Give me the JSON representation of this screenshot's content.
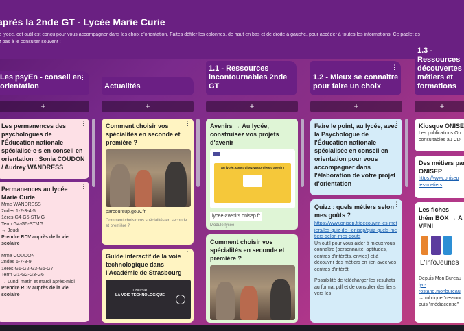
{
  "header": {
    "title": "après la 2nde GT - Lycée Marie Curie",
    "description": "e lycée, cet outil est conçu pour vous accompagner dans les choix d'orientation. Faites défiler les colonnes, de haut en bas et de droite à gauche, pour accéder à toutes les informations. Ce padlet es",
    "description2": "z pas à le consulter souvent !"
  },
  "columns": [
    {
      "title": "Les psyEn - conseil en orientation"
    },
    {
      "title": "Actualités"
    },
    {
      "title": "1.1 - Ressources incontournables 2nde GT"
    },
    {
      "title": "1.2 - Mieux se connaître pour faire un choix"
    },
    {
      "title": "1.3 - Ressources découvertes métiers et formations"
    }
  ],
  "add_symbol": "+",
  "menu_symbol": "⋮",
  "cards": {
    "c1a": {
      "title": "Les permanences des psychologues de l'Éducation nationale spécialisé-e-s en conseil en orientation : Sonia COUDON / Audrey WANDRESS"
    },
    "c1b": {
      "title": "Permanences au lycée Marie Curie",
      "l1": "Mme WANDRESS",
      "l2": "2ndes 1-2-3-4-5",
      "l3": "1ères G4-G5-STMG",
      "l4": "Term G4-G5-STMG",
      "l5": "→ Jeudi",
      "l6": "Prendre RDV auprès de la vie scolaire",
      "l7": "Mme COUDON",
      "l8": "2ndes 6-7-8-9",
      "l9": "1ères G1-G2-G3-G6-G7",
      "l10": "Term G1-G2-G3-G6",
      "l11": "→ Lundi matin et mardi après-midi",
      "l12": "Prendre RDV auprès de la vie scolaire"
    },
    "c2a": {
      "title": "Comment choisir vos spécialités en seconde et première ?",
      "link": "parcoursup.gouv.fr",
      "caption": "Comment choisir vos spécialités en seconde et première ?"
    },
    "c2b": {
      "title": "Guide interactif de la voie technologique dans l'Académie de Strasbourg",
      "img_text1": "CHOISIR",
      "img_text2": "LA VOIE TECHNOLOGIQUE"
    },
    "c3a": {
      "title": "Avenirs → Au lycée, construisez vos projets d'avenir",
      "img_text": "Au lycée, construisez vos projets d'avenir !",
      "link": "lycee-avenirs.onisep.fr",
      "caption": "Module lycée"
    },
    "c3b": {
      "title": "Comment choisir vos spécialités en seconde et première ?"
    },
    "c4a": {
      "title": "Faire le point, au lycée, avec la Psychologue de l'Éducation nationale spécialisée en conseil en orientation pour vous accompagner dans l'élaboration de votre projet d'orientation"
    },
    "c4b": {
      "title": "Quizz : quels métiers selon mes goûts ?",
      "link": "https://www.onisep.fr/decouvrir-les-metiers/les-quiz-de-l-onisep/quiz-quels-metiers-selon-mes-gouts",
      "text1": "Un outil pour vous aider à mieux vous connaître (personnalité, aptitudes, centres d'intérêts, envies) et à découvrir des métiers en lien avec vos centres d'intérêt.",
      "text2": "Possibilité de télécharger les résultats au format pdf et de consulter des liens vers les"
    },
    "c5a": {
      "title": "Kiosque ONISE",
      "text": "Les publications On consultables au CD"
    },
    "c5b": {
      "title": "Des métiers par ONISEP",
      "link": "https://www.onisep les-metiers"
    },
    "c5c": {
      "title": "Les fiches thém BOX → A VENI",
      "logo_text": "L'InfoJeunes",
      "text1": "Depuis Mon Bureau",
      "link": "lyc- rostand.monbureau",
      "text2": "→ rubrique \"ressour puis \"médiacentre\""
    }
  },
  "colors": {
    "header": "#6a2082",
    "column_head": "#6b1f84",
    "pink": "#fde0e6",
    "yellow": "#fff4c2",
    "green": "#dff5d6",
    "blue": "#d5ecf9"
  }
}
